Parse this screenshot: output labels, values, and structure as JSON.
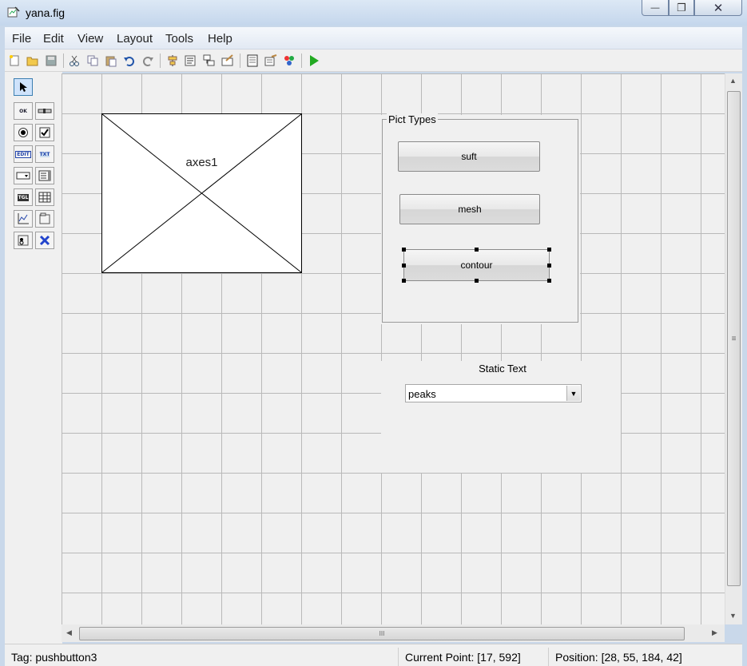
{
  "window": {
    "title": "yana.fig",
    "min": "—",
    "max": "❐",
    "close": "✕"
  },
  "menu": [
    "File",
    "Edit",
    "View",
    "Layout",
    "Tools",
    "Help"
  ],
  "canvas": {
    "axes_label": "axes1",
    "panel_title": "Pict Types",
    "buttons": [
      "suft",
      "mesh",
      "contour"
    ],
    "static_text": "Static Text",
    "popup_value": "peaks"
  },
  "status": {
    "tag": "Tag: pushbutton3",
    "current_point": "Current Point:  [17, 592]",
    "position": "Position: [28, 55, 184, 42]"
  },
  "scroll": {
    "grip_h": "III",
    "grip_v": "≡"
  }
}
